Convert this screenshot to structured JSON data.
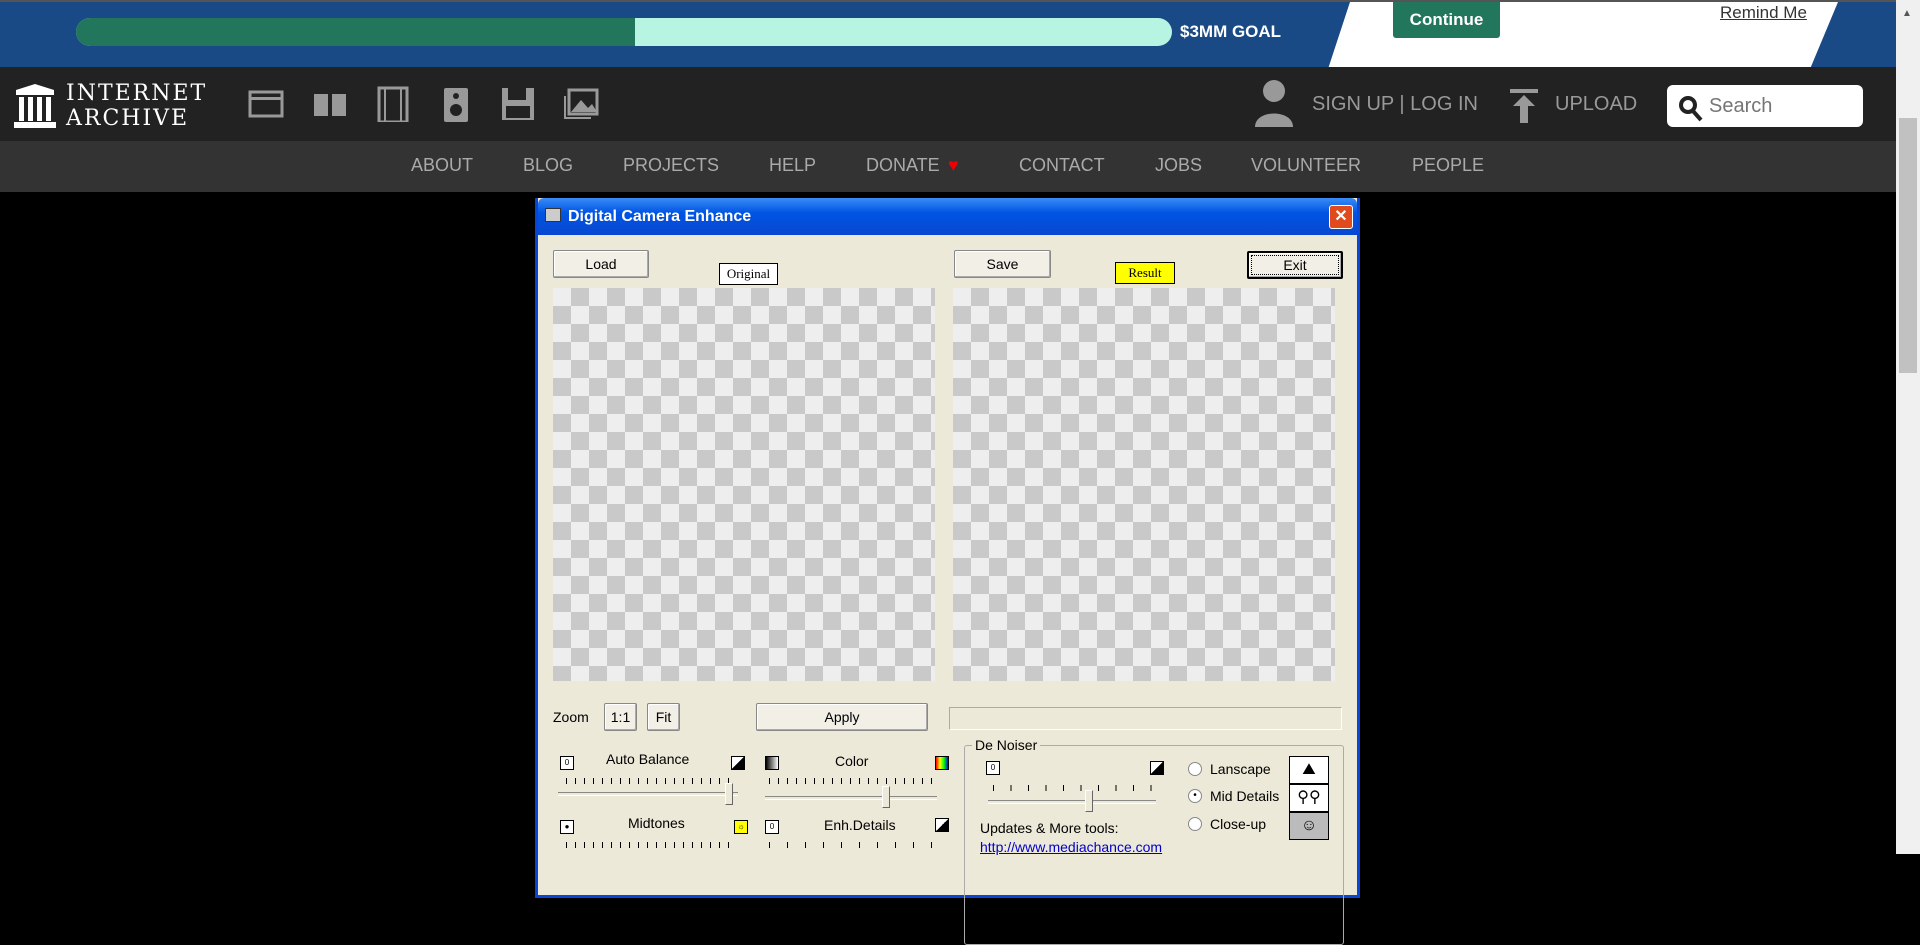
{
  "banner": {
    "progress_percent": 51,
    "goal_label": "$3MM GOAL",
    "continue_label": "Continue",
    "remind_label": "Remind Me",
    "colors": {
      "bg": "#1a4a85",
      "fill": "#22765c",
      "track": "#b8f4e2"
    }
  },
  "nav": {
    "logo_line1": "INTERNET",
    "logo_line2": "ARCHIVE",
    "media_icons": [
      "web-icon",
      "texts-icon",
      "video-icon",
      "audio-icon",
      "software-icon",
      "images-icon"
    ],
    "signup_login": "SIGN UP | LOG IN",
    "upload": "UPLOAD",
    "search_placeholder": "Search"
  },
  "menu": [
    "ABOUT",
    "BLOG",
    "PROJECTS",
    "HELP",
    "DONATE",
    "CONTACT",
    "JOBS",
    "VOLUNTEER",
    "PEOPLE"
  ],
  "dialog": {
    "title": "Digital Camera Enhance",
    "load": "Load",
    "original": "Original",
    "save": "Save",
    "result": "Result",
    "exit": "Exit",
    "zoom": "Zoom",
    "zoom_1_1": "1:1",
    "fit": "Fit",
    "apply": "Apply",
    "auto_balance": "Auto Balance",
    "color": "Color",
    "midtones": "Midtones",
    "enh_details": "Enh.Details",
    "denoiser": "De Noiser",
    "landscape": "Lanscape",
    "mid_details": "Mid Details",
    "close_up": "Close-up",
    "selected_mode": "Mid Details",
    "updates": "Updates & More tools:",
    "link": "http://www.mediachance.com",
    "slider_values": {
      "auto_balance": 1.0,
      "color": 0.72,
      "denoiser": 0.6
    }
  }
}
